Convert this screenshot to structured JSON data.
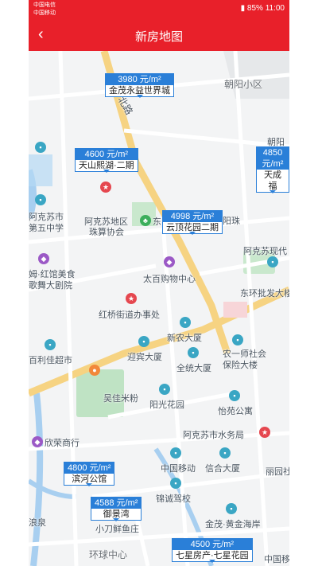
{
  "statusbar": {
    "carrier1": "中国电信",
    "carrier2": "中国移动",
    "battery": "85%",
    "time": "11:00"
  },
  "nav": {
    "back": "‹",
    "title": "新房地图"
  },
  "map": {
    "pois": [
      {
        "id": "chaoyang",
        "text": "朝阳小区"
      },
      {
        "id": "beilu",
        "text": "北路"
      },
      {
        "id": "chaoyang2",
        "text": "朝阳"
      },
      {
        "id": "akesu5",
        "text": "阿克苏市"
      },
      {
        "id": "akesu5b",
        "text": "第五中学"
      },
      {
        "id": "zhusuan",
        "text": "阿克苏地区"
      },
      {
        "id": "zhusuan2",
        "text": "珠算协会"
      },
      {
        "id": "hongguan",
        "text": "姆·红馆美食"
      },
      {
        "id": "hongguan2",
        "text": "歌舞大剧院"
      },
      {
        "id": "taibai",
        "text": "太百购物中心"
      },
      {
        "id": "hongqiao",
        "text": "红桥街道办事处"
      },
      {
        "id": "dongsan",
        "text": "东环批发大楼"
      },
      {
        "id": "xinnong",
        "text": "新农大厦"
      },
      {
        "id": "baili",
        "text": "百利佳超市"
      },
      {
        "id": "yingbin",
        "text": "迎宾大厦"
      },
      {
        "id": "quancheng",
        "text": "全统大厦"
      },
      {
        "id": "nongyi",
        "text": "农一师社会"
      },
      {
        "id": "nongyi2",
        "text": "保险大楼"
      },
      {
        "id": "wujia",
        "text": "吴佳米粉"
      },
      {
        "id": "yangguang",
        "text": "阳光花园"
      },
      {
        "id": "yiyuan",
        "text": "怡苑公寓"
      },
      {
        "id": "shuiwu",
        "text": "阿克苏市水务局"
      },
      {
        "id": "xinrong",
        "text": "欣荣商行"
      },
      {
        "id": "chinamobile",
        "text": "中国移动"
      },
      {
        "id": "xinhe",
        "text": "信合大厦"
      },
      {
        "id": "lirun",
        "text": "丽园社"
      },
      {
        "id": "jincheng",
        "text": "锦诚驾校"
      },
      {
        "id": "jinmao",
        "text": "金茂·黄金海岸"
      },
      {
        "id": "xiaodao",
        "text": "小刀鲜鱼庄"
      },
      {
        "id": "langquan",
        "text": "浪泉"
      },
      {
        "id": "huanqiu",
        "text": "环球中心"
      },
      {
        "id": "chinamobile2",
        "text": "中国移"
      },
      {
        "id": "xiandai",
        "text": "阿克苏现代"
      },
      {
        "id": "yangzhu",
        "text": "阳珠"
      },
      {
        "id": "dongzi",
        "text": "东"
      }
    ],
    "listings": [
      {
        "price": "3980 元/m²",
        "name": "金茂永益世界城"
      },
      {
        "price": "4600 元/m²",
        "name": "天山熙湖·二期"
      },
      {
        "price": "4850 元/m²",
        "name": "天成福"
      },
      {
        "price": "4998 元/m²",
        "name": "云顶花园二期"
      },
      {
        "price": "4800 元/m²",
        "name": "滨河公馆"
      },
      {
        "price": "4588 元/m²",
        "name": "御景湾"
      },
      {
        "price": "4500 元/m²",
        "name": "七星房产·七星花园"
      }
    ]
  }
}
